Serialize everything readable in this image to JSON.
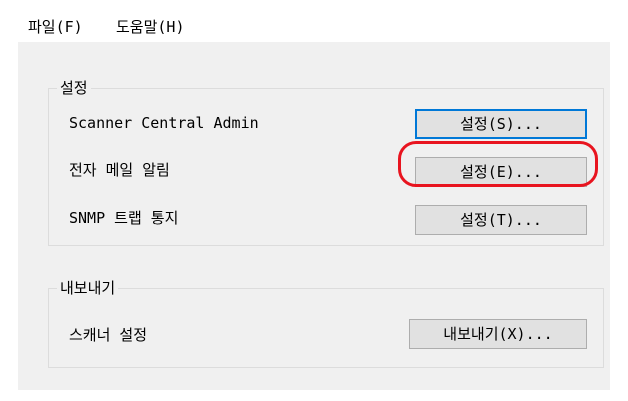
{
  "menubar": {
    "items": [
      {
        "label": "파일(F)"
      },
      {
        "label": "도움말(H)"
      }
    ]
  },
  "settings_group": {
    "title": "설정",
    "rows": [
      {
        "label": "Scanner Central Admin",
        "button": "설정(S)..."
      },
      {
        "label": "전자 메일 알림",
        "button": "설정(E)..."
      },
      {
        "label": "SNMP 트랩 통지",
        "button": "설정(T)..."
      }
    ]
  },
  "export_group": {
    "title": "내보내기",
    "rows": [
      {
        "label": "스캐너 설정",
        "button": "내보내기(X)..."
      }
    ]
  },
  "colors": {
    "focus_border": "#0078d7",
    "highlight_ring": "#e8141f"
  }
}
